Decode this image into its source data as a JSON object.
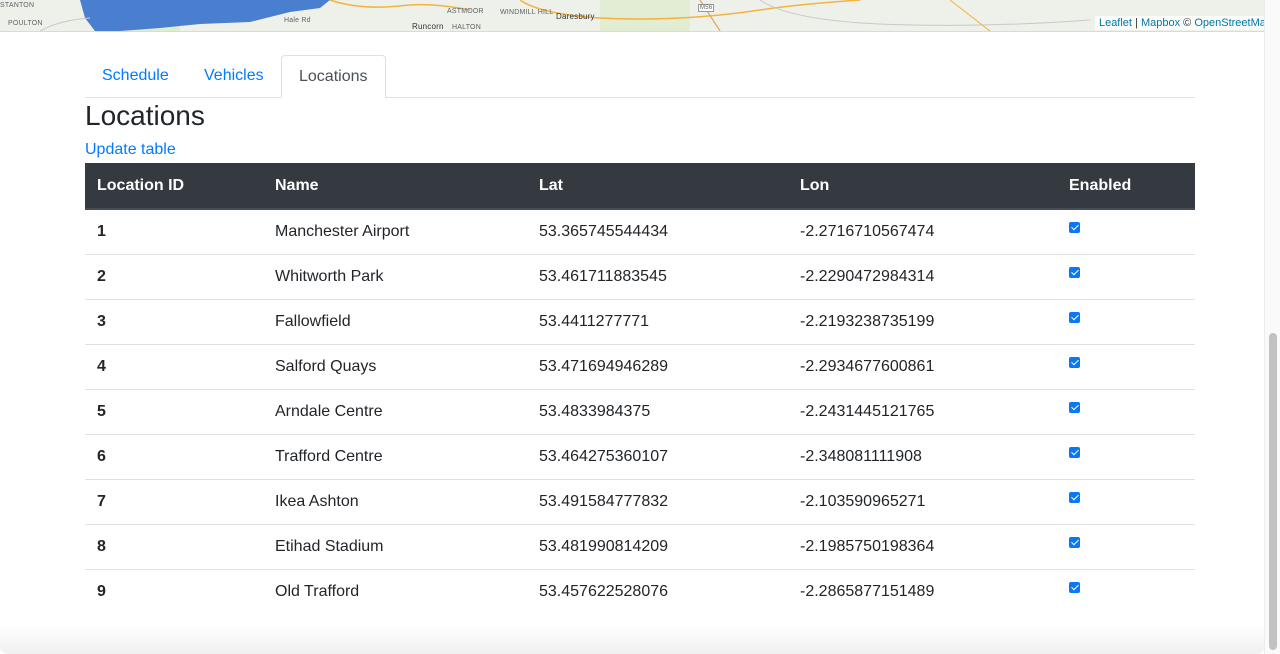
{
  "map": {
    "place_labels": [
      "STANTON",
      "POULTON",
      "Hale Rd",
      "Runcorn",
      "HALTON",
      "ASTMOOR",
      "WINDMILL HILL",
      "Daresbury",
      "M56"
    ],
    "attribution": {
      "leaflet": "Leaflet",
      "separator": "|",
      "mapbox": "Mapbox",
      "copyright": "©",
      "osm": "OpenStreetMap"
    }
  },
  "tabs": [
    {
      "label": "Schedule",
      "active": false
    },
    {
      "label": "Vehicles",
      "active": false
    },
    {
      "label": "Locations",
      "active": true
    }
  ],
  "section_title": "Locations",
  "update_link": "Update table",
  "table": {
    "headers": {
      "id": "Location ID",
      "name": "Name",
      "lat": "Lat",
      "lon": "Lon",
      "enabled": "Enabled"
    },
    "rows": [
      {
        "id": "1",
        "name": "Manchester Airport",
        "lat": "53.365745544434",
        "lon": "-2.2716710567474",
        "enabled": true
      },
      {
        "id": "2",
        "name": "Whitworth Park",
        "lat": "53.461711883545",
        "lon": "-2.2290472984314",
        "enabled": true
      },
      {
        "id": "3",
        "name": "Fallowfield",
        "lat": "53.4411277771",
        "lon": "-2.2193238735199",
        "enabled": true
      },
      {
        "id": "4",
        "name": "Salford Quays",
        "lat": "53.471694946289",
        "lon": "-2.2934677600861",
        "enabled": true
      },
      {
        "id": "5",
        "name": "Arndale Centre",
        "lat": "53.4833984375",
        "lon": "-2.2431445121765",
        "enabled": true
      },
      {
        "id": "6",
        "name": "Trafford Centre",
        "lat": "53.464275360107",
        "lon": "-2.348081111908",
        "enabled": true
      },
      {
        "id": "7",
        "name": "Ikea Ashton",
        "lat": "53.491584777832",
        "lon": "-2.103590965271",
        "enabled": true
      },
      {
        "id": "8",
        "name": "Etihad Stadium",
        "lat": "53.481990814209",
        "lon": "-2.1985750198364",
        "enabled": true
      },
      {
        "id": "9",
        "name": "Old Trafford",
        "lat": "53.457622528076",
        "lon": "-2.2865877151489",
        "enabled": true
      }
    ]
  },
  "colors": {
    "link": "#007bff",
    "table_header_bg": "#343a40",
    "checkbox": "#0a78f5",
    "water": "#4a7fd0"
  }
}
